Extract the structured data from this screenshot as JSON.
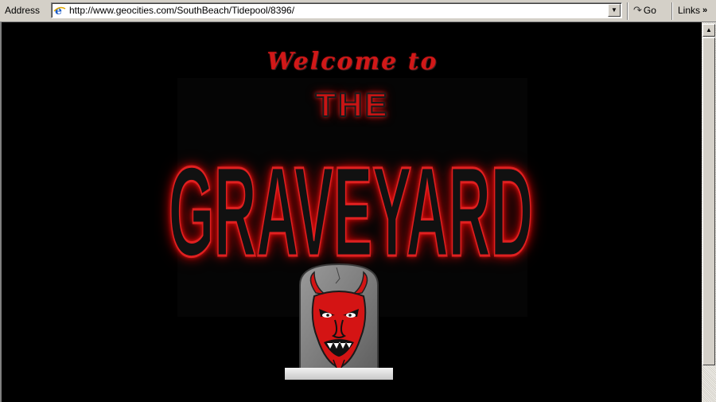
{
  "address_bar": {
    "label": "Address",
    "url": "http://www.geocities.com/SouthBeach/Tidepool/8396/",
    "go_label": "Go",
    "links_label": "Links",
    "links_chevron": "»",
    "dropdown_glyph": "▼",
    "go_glyph": "↷"
  },
  "page": {
    "welcome_text": "Welcome to",
    "the_text": "THE",
    "graveyard_text": "GRAVEYARD",
    "background_color": "#000000",
    "accent_color": "#d11818"
  },
  "images": {
    "tombstone": "devil-face-tombstone",
    "ie_logo": "internet-explorer-icon"
  },
  "scrollbar": {
    "up_glyph": "▲"
  }
}
